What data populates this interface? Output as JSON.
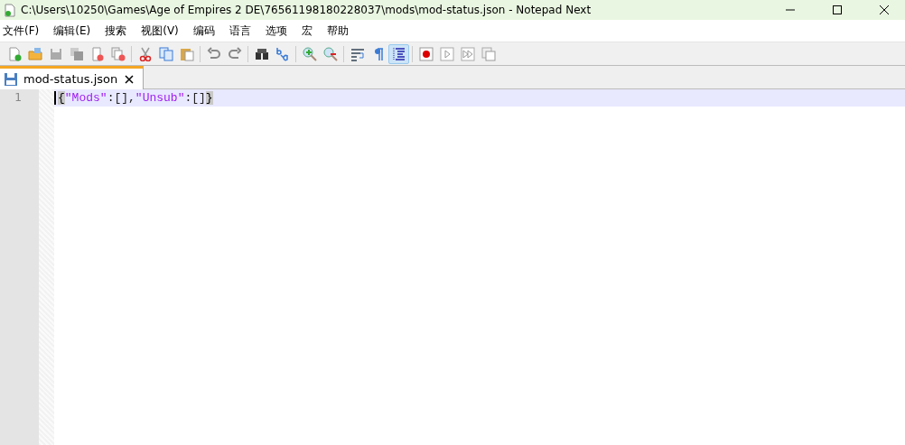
{
  "window": {
    "title": "C:\\Users\\10250\\Games\\Age of Empires 2 DE\\76561198180228037\\mods\\mod-status.json - Notepad Next"
  },
  "menu": [
    "文件(F)",
    "编辑(E)",
    "搜索",
    "视图(V)",
    "编码",
    "语言",
    "选项",
    "宏",
    "帮助"
  ],
  "toolbar": [
    [
      {
        "selected": false
      },
      {
        "selected": false
      },
      {
        "selected": false
      },
      {
        "selected": false
      },
      {
        "selected": false
      },
      {
        "selected": false
      }
    ],
    [
      {
        "selected": false
      },
      {
        "selected": false
      },
      {
        "selected": false
      }
    ],
    [
      {
        "selected": false
      },
      {
        "selected": false
      }
    ],
    [
      {
        "selected": false
      },
      {
        "selected": false
      }
    ],
    [
      {
        "selected": false
      },
      {
        "selected": false
      }
    ],
    [
      {
        "selected": false
      },
      {
        "selected": false
      },
      {
        "selected": true
      }
    ],
    [
      {
        "selected": false
      },
      {
        "selected": false
      },
      {
        "selected": false
      },
      {
        "selected": false
      }
    ]
  ],
  "tabs": [
    {
      "label": "mod-status.json",
      "selected": true
    }
  ],
  "editor": {
    "lines": [
      {
        "number": "1",
        "current": true,
        "tokens": [
          {
            "text": "{",
            "kind": "brace"
          },
          {
            "text": "\"Mods\"",
            "kind": "string"
          },
          {
            "text": ":[],",
            "kind": "punct"
          },
          {
            "text": "\"Unsub\"",
            "kind": "string"
          },
          {
            "text": ":[]",
            "kind": "punct"
          },
          {
            "text": "}",
            "kind": "brace"
          }
        ]
      }
    ]
  }
}
